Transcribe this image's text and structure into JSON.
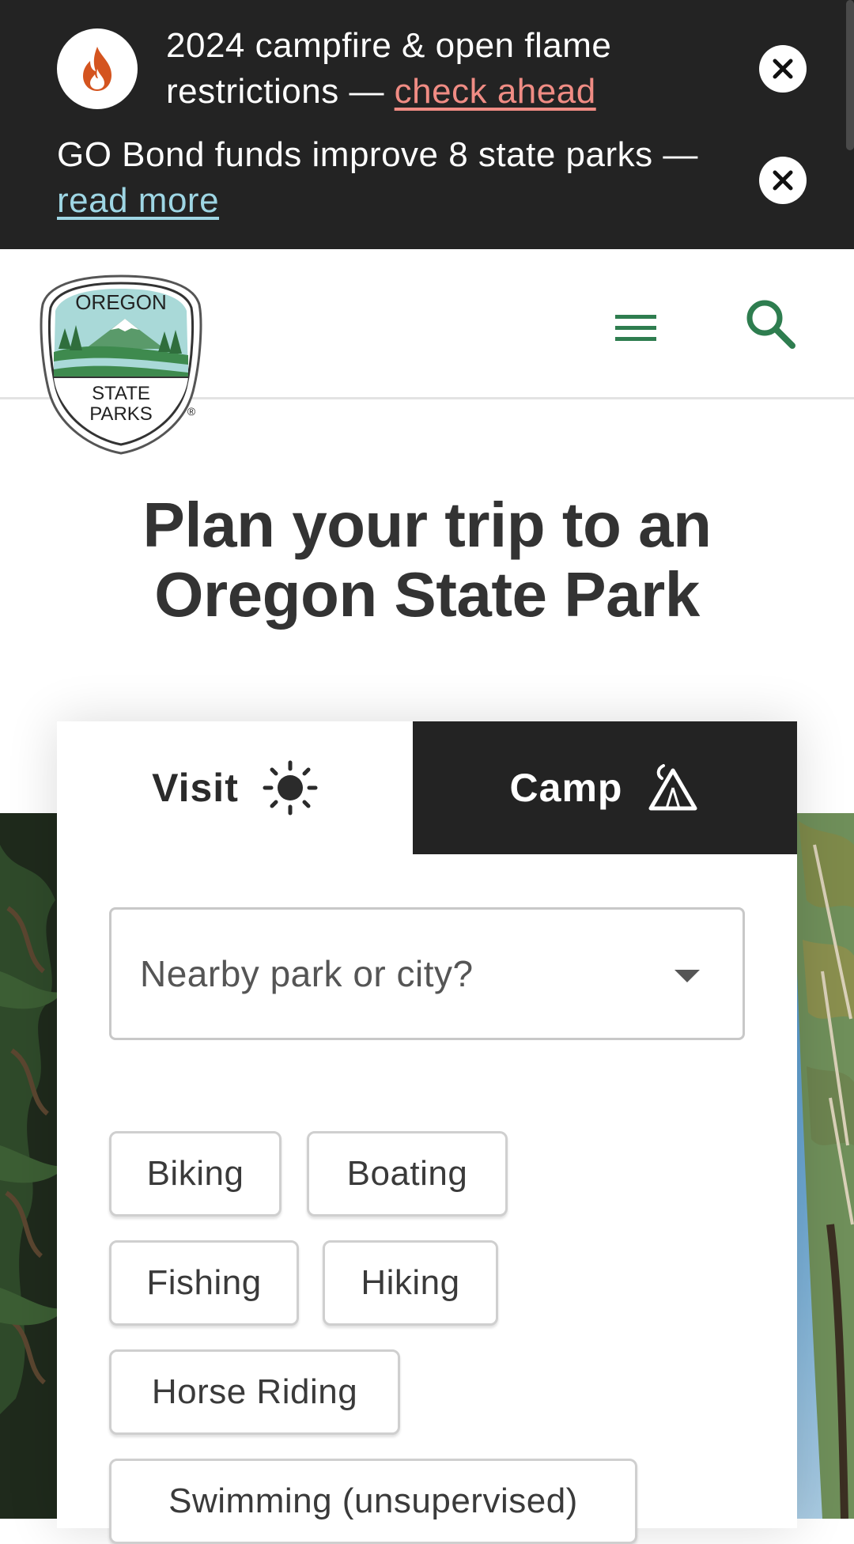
{
  "alerts": [
    {
      "text": "2024 campfire & open flame restrictions — ",
      "link": "check ahead",
      "icon": "flame-icon",
      "link_color": "#f08c84"
    },
    {
      "text": "GO Bond funds improve 8 state parks — ",
      "link": "read more",
      "link_color": "#9ed6e4"
    }
  ],
  "header": {
    "logo": {
      "line1": "OREGON",
      "line2": "STATE",
      "line3": "PARKS",
      "registered": "®"
    },
    "menu_icon": "hamburger-menu-icon",
    "search_icon": "search-icon",
    "accent_color": "#2e7d4f"
  },
  "page_title": "Plan your trip to an Oregon State Park",
  "planner": {
    "tabs": [
      {
        "label": "Visit",
        "icon": "sun-icon",
        "active": true
      },
      {
        "label": "Camp",
        "icon": "tent-icon",
        "active": false
      }
    ],
    "location_placeholder": "Nearby park or city?",
    "activities": [
      "Biking",
      "Boating",
      "Fishing",
      "Hiking",
      "Horse Riding",
      "Swimming (unsupervised)"
    ]
  },
  "colors": {
    "banner_bg": "#232323",
    "title_text": "#333333",
    "camp_tab_bg": "#232323"
  }
}
